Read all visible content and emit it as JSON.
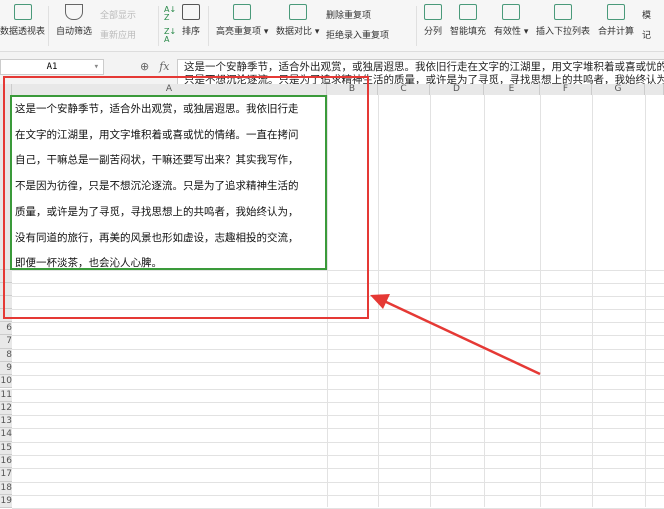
{
  "ribbon": {
    "pivot": "数据透视表",
    "autofilter": "自动筛选",
    "show_all": "全部显示",
    "reapply": "重新应用",
    "sort": "排序",
    "highlight_dup": "高亮重复项",
    "compare": "数据对比",
    "delete_dup": "删除重复项",
    "reject_dup": "拒绝录入重复项",
    "split": "分列",
    "smart_fill": "智能填充",
    "validity": "有效性",
    "dropdown": "插入下拉列表",
    "consolidate": "合并计算",
    "more1": "模",
    "more2": "记"
  },
  "formula_bar": {
    "name_box": "A1",
    "fx": "fx",
    "line1": "这是一个安静季节，适合外出观赏，或独居遐思。我依旧行走在文字的江湖里，用文字堆积着或喜或忧的情绪。",
    "line2": "只是不想沉沦逐流。只是为了追求精神生活的质量，或许是为了寻觅，寻找思想上的共鸣者，我始终认为，"
  },
  "columns": [
    "A",
    "B",
    "C",
    "D",
    "E",
    "F",
    "G"
  ],
  "rows": [
    "6",
    "7",
    "8",
    "9",
    "10",
    "11",
    "12",
    "13",
    "14",
    "15",
    "16",
    "17",
    "18",
    "19"
  ],
  "cell_a1_lines": [
    "这是一个安静季节，适合外出观赏，或独居遐思。我依旧行走",
    "在文字的江湖里，用文字堆积着或喜或忧的情绪。一直在拷问",
    "自己，干嘛总是一副苦闷状，干嘛还要写出来？其实我写作，",
    "不是因为彷徨，只是不想沉沦逐流。只是为了追求精神生活的",
    "质量，或许是为了寻觅，寻找思想上的共鸣者，我始终认为，",
    "没有同道的旅行，再美的风景也形如虚设，志趣相投的交流，",
    "即便一杯淡茶，也会沁人心脾。"
  ],
  "colors": {
    "annotation": "#e53935",
    "selection": "#3a9a3a"
  }
}
